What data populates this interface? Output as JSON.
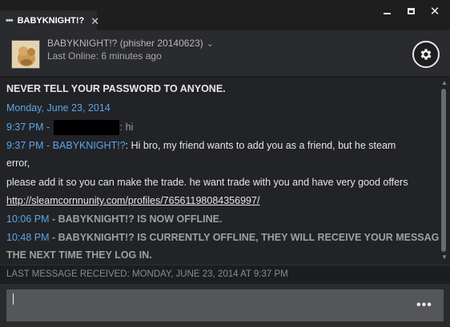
{
  "tab": {
    "dots": "•••",
    "title": "BABYKNIGHT!?",
    "close": "✕"
  },
  "window": {
    "minimize": "minimize",
    "maximize": "maximize",
    "close": "✕"
  },
  "header": {
    "name": "BABYKNIGHT!? (phisher 20140623)",
    "chevron": "⌄",
    "last_online": "Last Online: 6 minutes ago",
    "settings_icon": "gear-icon"
  },
  "chat": {
    "warning": "NEVER TELL YOUR PASSWORD TO ANYONE.",
    "date": "Monday, June 23, 2014",
    "m1": {
      "time": "9:37 PM",
      "sep": " - ",
      "text": ": hi"
    },
    "m2": {
      "prefix": "9:37 PM - BABYKNIGHT!?",
      "text": ": Hi bro, my friend wants to add you as a friend, but he steam"
    },
    "m2_cont": "error,",
    "m3": "please add it so you can make the trade. he want trade with you and have very good offers",
    "m4_link": "http://sleamcornnunity.com/profiles/76561198084356997/",
    "m5": {
      "time": "10:06 PM",
      "text": " - BABYKNIGHT!? IS NOW OFFLINE."
    },
    "m6": {
      "time": "10:48 PM",
      "text": " - BABYKNIGHT!? IS CURRENTLY OFFLINE, THEY WILL RECEIVE YOUR MESSAGE"
    },
    "m6_cont": "THE NEXT TIME THEY LOG IN."
  },
  "status": {
    "text": "LAST MESSAGE RECEIVED: MONDAY, JUNE 23, 2014 AT 9:37 PM"
  },
  "input": {
    "value": "",
    "more": "•••"
  },
  "colors": {
    "accent_blue": "#5aa6ea",
    "background": "#1e1e1e",
    "panel": "#2a2b2e",
    "input": "#555659"
  }
}
